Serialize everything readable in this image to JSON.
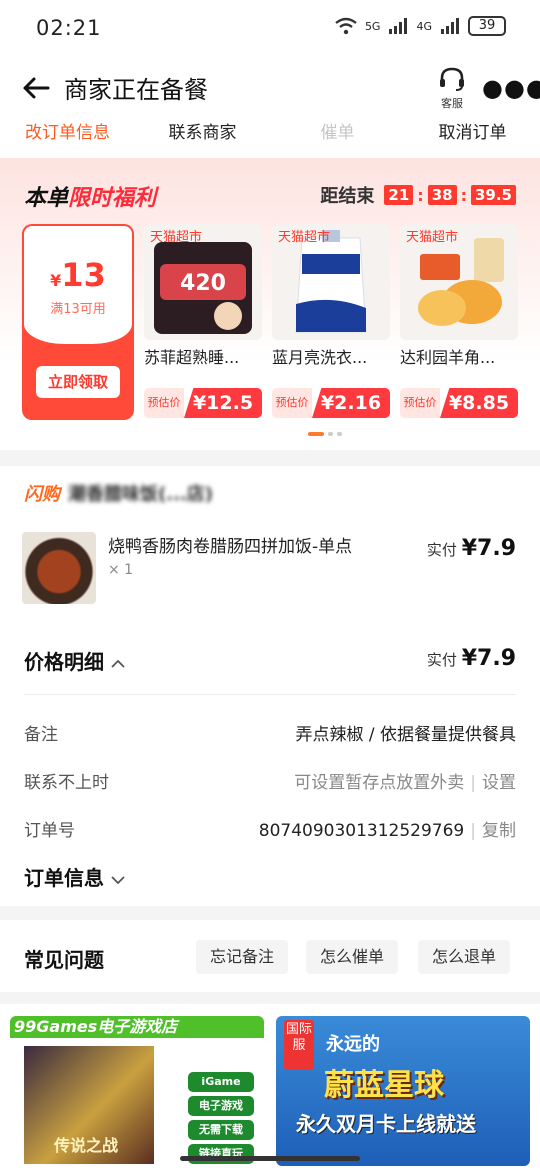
{
  "status_bar": {
    "time": "02:21",
    "net1": "5G",
    "net2": "4G",
    "battery": "39"
  },
  "header": {
    "title": "商家正在备餐",
    "customer_service": "客服",
    "actions": [
      "改订单信息",
      "联系商家",
      "催单",
      "取消订单"
    ]
  },
  "promo": {
    "title_a": "本单",
    "title_b": "限时福利",
    "countdown_label": "距结束",
    "countdown": [
      "21",
      "38",
      "39.5"
    ],
    "coupon": {
      "currency": "¥",
      "amount": "13",
      "condition": "满13可用",
      "button": "立即领取"
    },
    "products": [
      {
        "tag": "天猫超市",
        "name": "苏菲超熟睡...",
        "est_label": "预估价",
        "price": "¥12.5"
      },
      {
        "tag": "天猫超市",
        "name": "蓝月亮洗衣...",
        "est_label": "预估价",
        "price": "¥2.16"
      },
      {
        "tag": "天猫超市",
        "name": "达利园羊角...",
        "est_label": "预估价",
        "price": "¥8.85"
      }
    ]
  },
  "order": {
    "flash_label": "闪购",
    "shop_name": "潮香腊味饭(...店)",
    "item_name": "烧鸭香肠肉卷腊肠四拼加饭-单点",
    "item_qty": "× 1",
    "paid_label": "实付",
    "item_paid": "¥7.9",
    "price_detail_title": "价格明细",
    "total_paid": "¥7.9",
    "note_label": "备注",
    "note_value": "弄点辣椒 / 依据餐量提供餐具",
    "unreachable_label": "联系不上时",
    "unreachable_value": "可设置暂存点放置外卖",
    "unreachable_action": "设置",
    "order_no_label": "订单号",
    "order_no": "8074090301312529769",
    "copy_label": "复制",
    "order_info_title": "订单信息"
  },
  "faq": {
    "title": "常见问题",
    "chips": [
      "忘记备注",
      "怎么催单",
      "怎么退单"
    ]
  },
  "ads": {
    "ad1_title": "99Games电子游戏店",
    "ad1_buttons": [
      "iGame",
      "电子游戏",
      "无需下载",
      "链接直玩"
    ],
    "ad1_caption": "传说之战",
    "ad2_badge": "国际服",
    "ad2_l1": "永远的",
    "ad2_l2": "蔚蓝星球",
    "ad2_l3": "永久双月卡上线就送"
  },
  "colors": {
    "accent": "#ff5a1f",
    "price_red": "#ff3a2f"
  }
}
